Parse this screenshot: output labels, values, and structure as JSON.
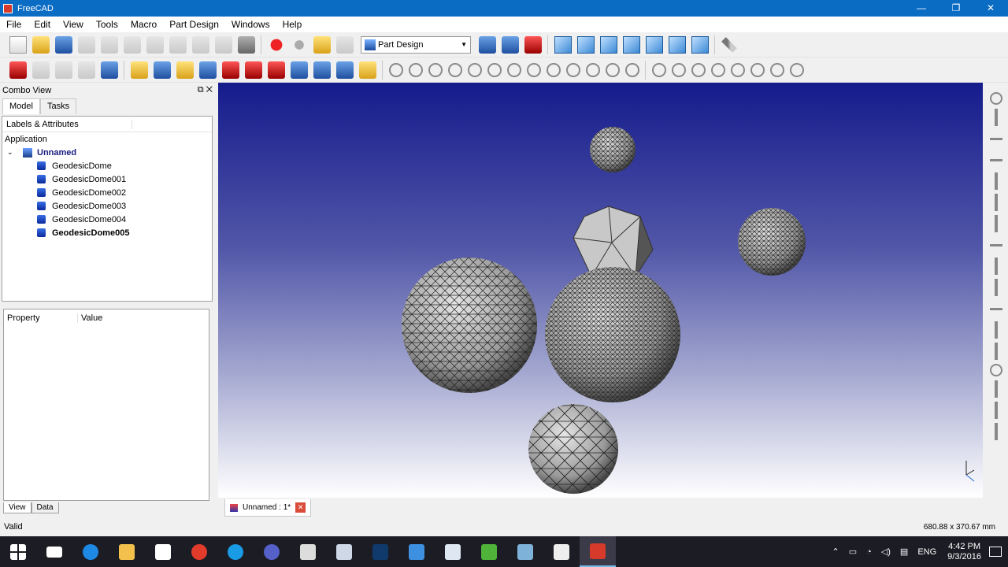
{
  "window": {
    "title": "FreeCAD",
    "minimize": "—",
    "maximize": "❐",
    "close": "✕"
  },
  "menu": [
    "File",
    "Edit",
    "View",
    "Tools",
    "Macro",
    "Part Design",
    "Windows",
    "Help"
  ],
  "toolbar": {
    "workbench": "Part Design"
  },
  "combo": {
    "title": "Combo View",
    "tabs": [
      "Model",
      "Tasks"
    ],
    "tree_header": "Labels & Attributes",
    "application": "Application",
    "document": "Unnamed",
    "objects": [
      "GeodesicDome",
      "GeodesicDome001",
      "GeodesicDome002",
      "GeodesicDome003",
      "GeodesicDome004",
      "GeodesicDome005"
    ],
    "property_header": "Property",
    "value_header": "Value",
    "bottom_tabs": [
      "View",
      "Data"
    ]
  },
  "view": {
    "doc_tab": "Unnamed : 1*"
  },
  "status": {
    "left": "Valid",
    "right": "680.88 x 370.67 mm"
  },
  "taskbar": {
    "lang": "ENG",
    "time": "4:42 PM",
    "date": "9/3/2016"
  },
  "colors": {
    "titlebar": "#0b6cc4",
    "viewTop": "#151b8c",
    "viewBottom": "#ffffff"
  }
}
